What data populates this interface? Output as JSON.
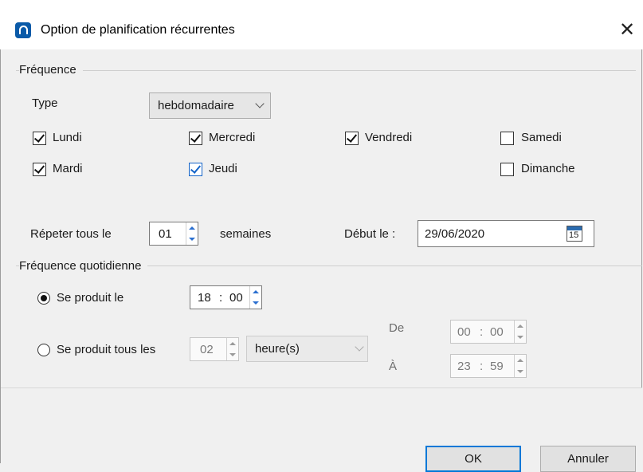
{
  "window": {
    "title": "Option de planification récurrentes",
    "close_glyph": "✕"
  },
  "frequence": {
    "group_title": "Fréquence",
    "type_label": "Type",
    "type_value": "hebdomadaire",
    "days": [
      {
        "label": "Lundi",
        "checked": true
      },
      {
        "label": "Mercredi",
        "checked": true
      },
      {
        "label": "Vendredi",
        "checked": true
      },
      {
        "label": "Samedi",
        "checked": false
      },
      {
        "label": "Mardi",
        "checked": true
      },
      {
        "label": "Jeudi",
        "checked": true
      },
      {
        "label": "Dimanche",
        "checked": false
      }
    ],
    "repeat_label": "Répeter tous le",
    "repeat_value": "01",
    "repeat_unit": "semaines",
    "start_label": "Début le :",
    "start_date": "29/06/2020",
    "calendar_day": "15"
  },
  "quotidienne": {
    "group_title": "Fréquence quotidienne",
    "once_label": "Se produit le",
    "once_hour": "18",
    "once_minute": "00",
    "every_label": "Se produit tous les",
    "every_value": "02",
    "every_unit": "heure(s)",
    "from_label": "De",
    "from_hour": "00",
    "from_minute": "00",
    "to_label": "À",
    "to_hour": "23",
    "to_minute": "59"
  },
  "footer": {
    "ok_label": "OK",
    "cancel_label": "Annuler"
  },
  "colors": {
    "accent": "#0078d7",
    "check_blue": "#1464c8"
  },
  "icons": {
    "app": "app-icon",
    "close": "close-icon",
    "calendar": "calendar-icon"
  }
}
